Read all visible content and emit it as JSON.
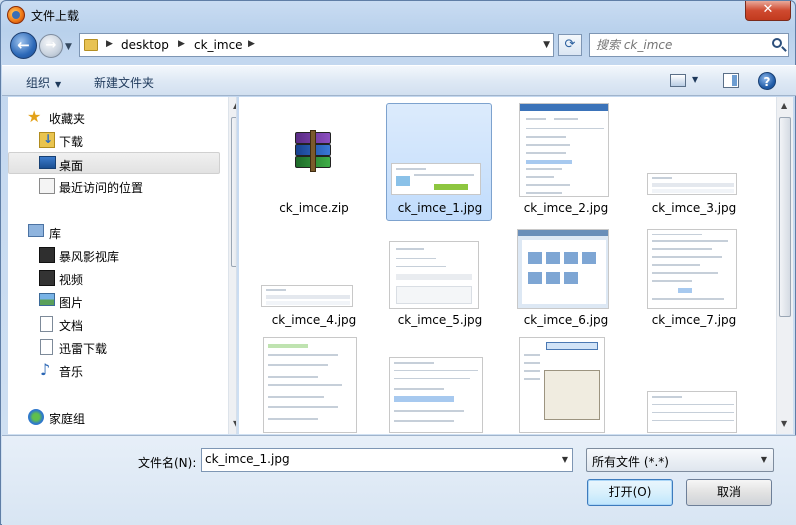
{
  "window": {
    "title": "文件上载"
  },
  "address": {
    "crumbs": [
      "desktop",
      "ck_imce"
    ],
    "search_placeholder": "搜索 ck_imce"
  },
  "toolbar": {
    "organize": "组织",
    "new_folder": "新建文件夹"
  },
  "sidebar": {
    "favorites": "收藏夹",
    "downloads": "下载",
    "desktop": "桌面",
    "recent": "最近访问的位置",
    "libraries": "库",
    "storm_video": "暴风影视库",
    "videos": "视频",
    "pictures": "图片",
    "documents": "文档",
    "thunder": "迅雷下载",
    "music": "音乐",
    "homegroup": "家庭组"
  },
  "files": [
    {
      "name": "ck_imce.zip"
    },
    {
      "name": "ck_imce_1.jpg"
    },
    {
      "name": "ck_imce_2.jpg"
    },
    {
      "name": "ck_imce_3.jpg"
    },
    {
      "name": "ck_imce_4.jpg"
    },
    {
      "name": "ck_imce_5.jpg"
    },
    {
      "name": "ck_imce_6.jpg"
    },
    {
      "name": "ck_imce_7.jpg"
    },
    {
      "name": ""
    },
    {
      "name": ""
    },
    {
      "name": ""
    },
    {
      "name": ""
    }
  ],
  "bottom": {
    "filename_label": "文件名(N):",
    "filename_value": "ck_imce_1.jpg",
    "filter_value": "所有文件 (*.*)",
    "open_label": "打开(O)",
    "cancel_label": "取消"
  },
  "colors": {
    "selection": "#c1dcfc",
    "accent": "#3d7bbd"
  }
}
